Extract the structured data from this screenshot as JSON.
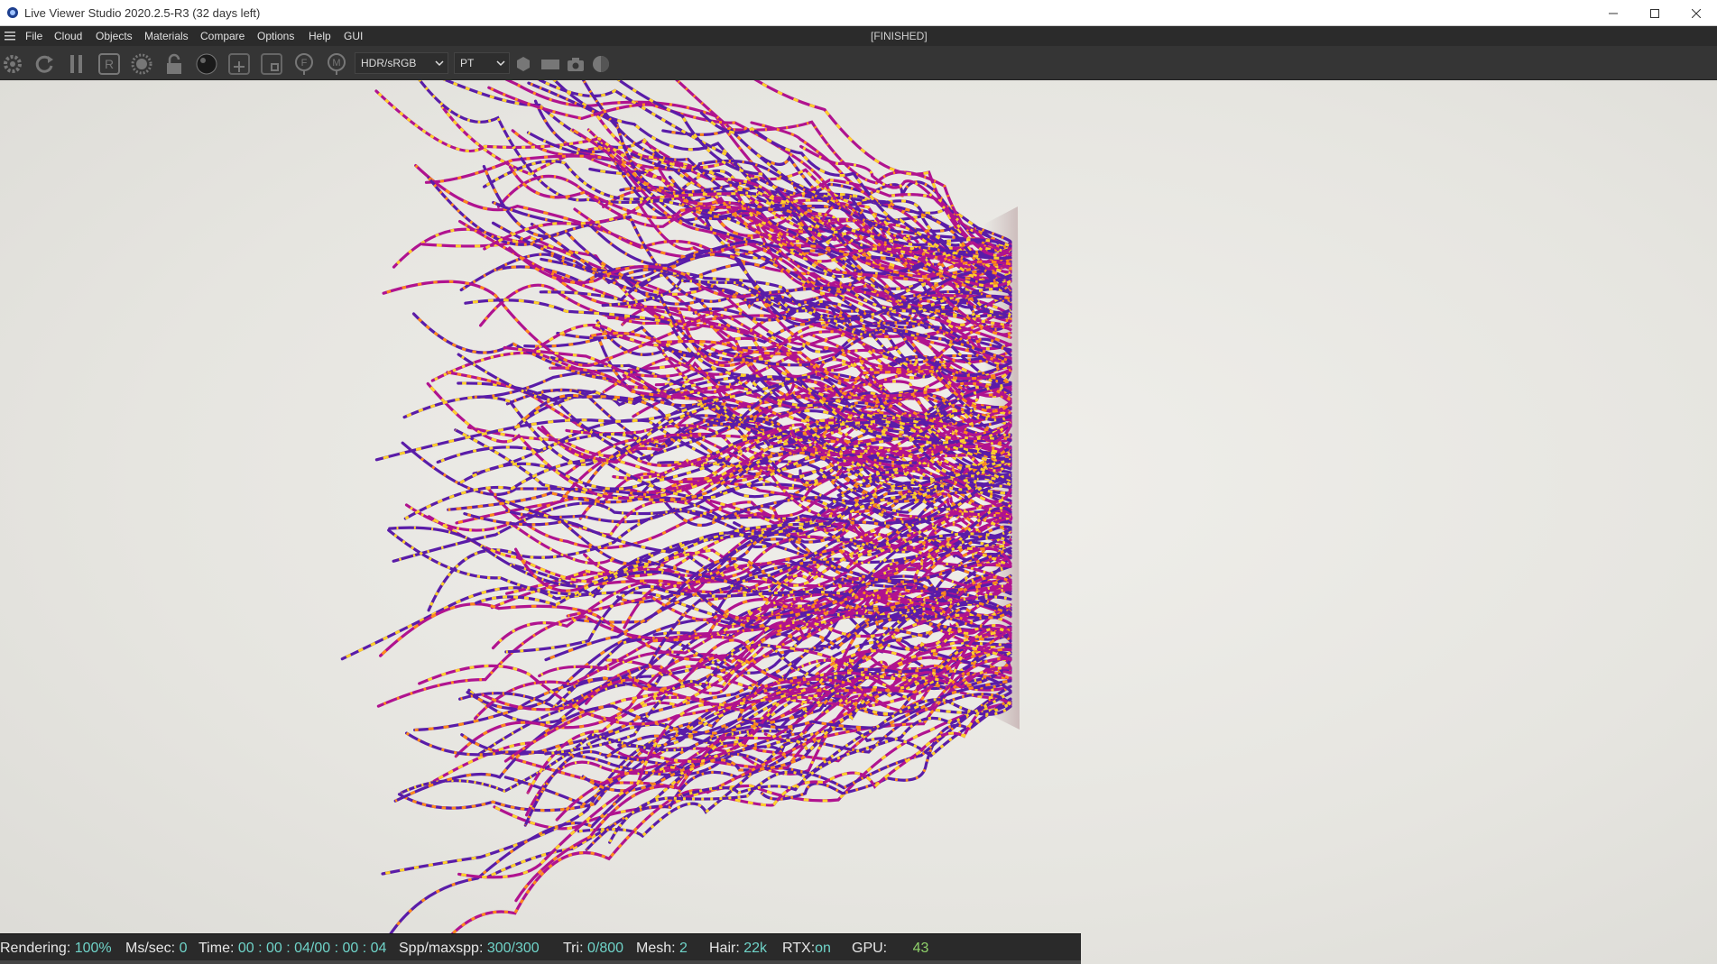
{
  "window": {
    "title": "Live Viewer Studio 2020.2.5-R3 (32 days left)",
    "controls": [
      "minimize",
      "maximize",
      "close"
    ]
  },
  "menubar": {
    "items": [
      "File",
      "Cloud",
      "Objects",
      "Materials",
      "Compare",
      "Options",
      "Help",
      "GUI"
    ],
    "status": "[FINISHED]"
  },
  "toolbar": {
    "icons": [
      "settings-gear-icon",
      "refresh-icon",
      "pause-icon",
      "r-icon",
      "sun-icon",
      "unlock-icon",
      "sphere-icon",
      "add-region-icon",
      "region-icon",
      "focus-pin-icon",
      "material-pin-icon"
    ],
    "color_space": "HDR/sRGB",
    "render_mode": "PT",
    "right_icons": [
      "hexagon-icon",
      "rectangle-icon",
      "camera-icon",
      "half-sphere-icon"
    ]
  },
  "status": {
    "rendering_label": "Rendering:",
    "rendering_value": "100%",
    "mssec_label": "Ms/sec:",
    "mssec_value": "0",
    "time_label": "Time:",
    "time_value": "00 : 00 : 04/00 : 00 : 04",
    "spp_label": "Spp/maxspp:",
    "spp_value": "300/300",
    "tri_label": "Tri:",
    "tri_value": "0/800",
    "mesh_label": "Mesh:",
    "mesh_value": "2",
    "hair_label": "Hair:",
    "hair_value": "22k",
    "rtx_label": "RTX:",
    "rtx_value": "on",
    "gpu_label": "GPU:",
    "gpu_value": "43"
  },
  "colors": {
    "hair_base": "#b0138f",
    "hair_dark": "#5a1ca8",
    "hair_hot": "#ff8a1a",
    "hair_highlight": "#ffd02a",
    "viewport_bg": "#e8e7e2",
    "value_text": "#6fd3c8"
  }
}
